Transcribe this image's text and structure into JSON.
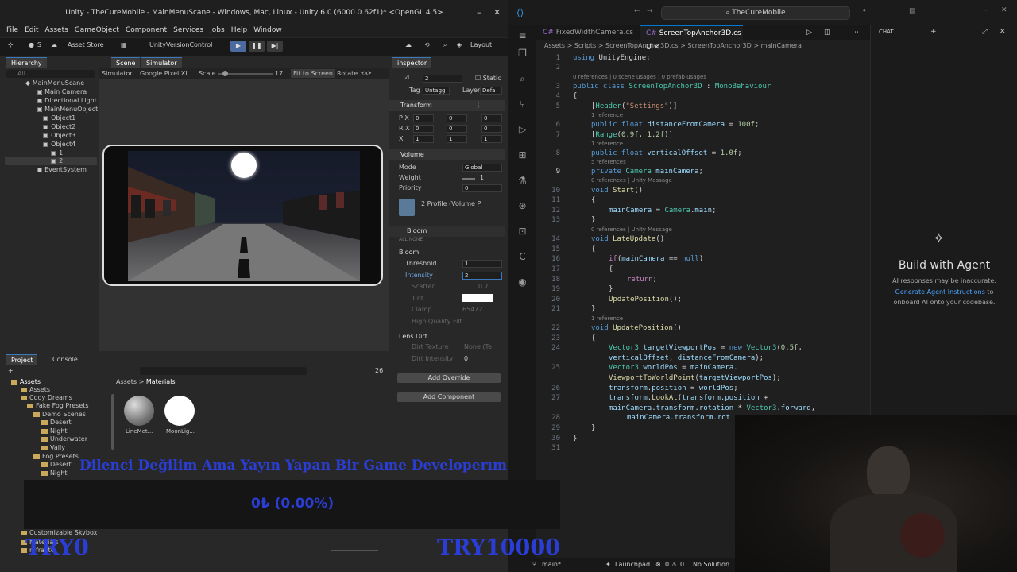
{
  "unity": {
    "title": "Unity - TheCureMobile - MainMenuScane - Windows, Mac, Linux - Unity 6.0 (6000.0.62f1)* <OpenGL 4.5>",
    "menu": [
      "File",
      "Edit",
      "Assets",
      "GameObject",
      "Component",
      "Services",
      "Jobs",
      "Help",
      "Window"
    ],
    "toolbar": {
      "account": "S",
      "asset_store": "Asset Store",
      "version_control": "UnityVersionControl",
      "layout": "Layout"
    },
    "tabs": {
      "hierarchy": "Hierarchy",
      "scene": "Scene",
      "simulator": "Simulator",
      "inspector": "inspector"
    },
    "hierarchy": {
      "search": "All",
      "items": [
        "MainMenuScane",
        "Main Camera",
        "Directional Light",
        "MainMenuObject",
        "Object1",
        "Object2",
        "Object3",
        "Object4",
        "1",
        "2",
        "EventSystem"
      ]
    },
    "simulator_bar": {
      "mode": "Simulator",
      "device": "Google Pixel XL",
      "scale_label": "Scale",
      "scale_value": "17",
      "fit": "Fit to Screen",
      "rotate": "Rotate"
    },
    "inspector": {
      "object_name": "2",
      "static_label": "Static",
      "tag_label": "Tag",
      "tag_value": "Untagg",
      "layer_label": "Layer",
      "layer_value": "Defa",
      "transform": {
        "title": "Transform",
        "rows": [
          {
            "label": "P X",
            "x": "0",
            "y": "0",
            "z": "0"
          },
          {
            "label": "R X",
            "x": "0",
            "y": "0",
            "z": "0"
          },
          {
            "label": "X",
            "x": "1",
            "y": "1",
            "z": "1"
          }
        ]
      },
      "volume": {
        "title": "Volume",
        "mode_label": "Mode",
        "mode_value": "Global",
        "weight_label": "Weight",
        "weight_value": "1",
        "priority_label": "Priority",
        "priority_value": "0",
        "profile": "2 Profile (Volume P"
      },
      "bloom": {
        "title": "Bloom",
        "all_none": "ALL  NONE",
        "section": "Bloom",
        "threshold_label": "Threshold",
        "threshold_value": "1",
        "intensity_label": "Intensity",
        "intensity_value": "2",
        "scatter_label": "Scatter",
        "scatter_value": "0.7",
        "tint_label": "Tint",
        "clamp_label": "Clamp",
        "clamp_value": "65472",
        "hq_label": "High Quality Filt",
        "lens_dirt": "Lens Dirt",
        "dirt_texture_label": "Dirt Texture",
        "dirt_texture_value": "None (Te",
        "dirt_intensity_label": "Dirt Intensity",
        "dirt_intensity_value": "0"
      },
      "add_override": "Add Override",
      "add_component": "Add Component"
    },
    "project": {
      "tab_project": "Project",
      "tab_console": "Console",
      "count": "26",
      "breadcrumb": [
        "Assets",
        "Materials"
      ],
      "tree": [
        "Assets",
        "Assets",
        "Cody Dreams",
        "Fake Fog Presets",
        "Demo Scenes",
        "Desert",
        "Night",
        "Underwater",
        "Vally",
        "Fog Presets",
        "Desert",
        "Night",
        "Customizable Skybox",
        "Materials",
        "refrakte"
      ],
      "materials": [
        "LineMet...",
        "MoonLig..."
      ]
    }
  },
  "overlay": {
    "message": "Dilenci Değilim Ama Yayın Yapan Bir Game Developerım",
    "donation": "0₺ (0.00%)",
    "try_left": "TRY0",
    "try_right": "TRY10000"
  },
  "vscode": {
    "search": "TheCureMobile",
    "tabs": [
      "FixedWidthCamera.cs",
      "ScreenTopAnchor3D.cs U"
    ],
    "breadcrumb": "Assets > Scripts > ScreenTopAnchor3D.cs > ScreenTopAnchor3D > mainCamera",
    "chat": {
      "title": "CHAT",
      "heading": "Build with Agent",
      "disclaimer": "AI responses may be inaccurate.",
      "link": "Generate Agent Instructions",
      "link_tail": " to",
      "line3": "onboard AI onto your codebase."
    },
    "status": {
      "branch": "main*",
      "launchpad": "Launchpad",
      "errors": "0",
      "warnings": "0",
      "solution": "No Solution"
    }
  },
  "colors": {
    "accent": "#0078d4",
    "overlay_blue": "#2a3ed6",
    "unity_select": "#3a79bb"
  }
}
